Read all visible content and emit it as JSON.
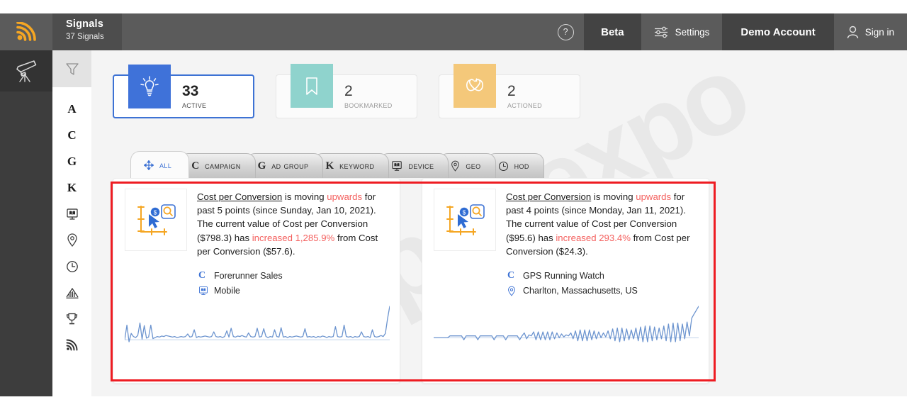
{
  "header": {
    "logo_icon": "rss-signal-icon",
    "title": "Signals",
    "subtitle": "37 Signals",
    "help_icon": "question-circle-icon",
    "beta_label": "Beta",
    "settings_icon": "sliders-icon",
    "settings_label": "Settings",
    "account_label": "Demo Account",
    "signin_icon": "user-icon",
    "signin_label": "Sign in"
  },
  "rail_dark": {
    "items": [
      {
        "name": "telescope-icon",
        "label": "Telescope"
      }
    ]
  },
  "rail_light": {
    "filter_icon": "filter-funnel-icon",
    "items": [
      {
        "icon": "letter-a-icon",
        "label": "A",
        "type": "letter"
      },
      {
        "icon": "letter-c-icon",
        "label": "C",
        "type": "letter"
      },
      {
        "icon": "letter-g-icon",
        "label": "G",
        "type": "letter"
      },
      {
        "icon": "letter-k-icon",
        "label": "K",
        "type": "letter"
      },
      {
        "icon": "device-monitor-icon",
        "label": "",
        "type": "glyph"
      },
      {
        "icon": "location-pin-icon",
        "label": "",
        "type": "glyph"
      },
      {
        "icon": "clock-icon",
        "label": "",
        "type": "glyph"
      },
      {
        "icon": "bar-chart-icon",
        "label": "",
        "type": "glyph"
      },
      {
        "icon": "trophy-icon",
        "label": "",
        "type": "glyph"
      },
      {
        "icon": "rss-signal-icon",
        "label": "",
        "type": "glyph"
      }
    ]
  },
  "watermark": {
    "text": "ppcexpo"
  },
  "stats": [
    {
      "count": "33",
      "label": "Active",
      "icon": "lightbulb-icon",
      "color": "#3f72d9",
      "state": "active"
    },
    {
      "count": "2",
      "label": "Bookmarked",
      "icon": "bookmark-icon",
      "color": "#8fd3cd",
      "state": "normal"
    },
    {
      "count": "2",
      "label": "Actioned",
      "icon": "actioned-link-icon",
      "color": "#f4c87a",
      "state": "normal"
    }
  ],
  "tabs": [
    {
      "label": "All",
      "icon": "move-arrows-icon",
      "selected": true
    },
    {
      "label": "Campaign",
      "icon": "letter-c-icon",
      "selected": false
    },
    {
      "label": "Ad Group",
      "icon": "letter-g-icon",
      "selected": false
    },
    {
      "label": "Keyword",
      "icon": "letter-k-icon",
      "selected": false
    },
    {
      "label": "Device",
      "icon": "device-monitor-icon",
      "selected": false
    },
    {
      "label": "Geo",
      "icon": "location-pin-icon",
      "selected": false
    },
    {
      "label": "HoD",
      "icon": "clock-icon",
      "selected": false
    }
  ],
  "cards": [
    {
      "thumb_icon": "money-chart-search-icon",
      "metric": "Cost per Conversion",
      "text_1": " is moving ",
      "direction": "upwards",
      "text_2": " for past 5 points (since Sunday, Jan 10, 2021). The current value of Cost per Conversion ($798.3) has ",
      "change": "increased 1,285.9%",
      "text_3": " from Cost per Conversion ($57.6).",
      "meta": [
        {
          "icon": "letter-c-icon",
          "label": "Forerunner Sales"
        },
        {
          "icon": "device-monitor-icon",
          "label": "Mobile"
        }
      ],
      "sparkline": {
        "color": "#6c94cf",
        "points": [
          14,
          42,
          10,
          26,
          20,
          18,
          22,
          46,
          15,
          41,
          17,
          19,
          42,
          16,
          18,
          20,
          19,
          21,
          20,
          22,
          21,
          20,
          19,
          20,
          18,
          19,
          20,
          19,
          20,
          25,
          19,
          20,
          33,
          18,
          20,
          19,
          20,
          21,
          20,
          19,
          20,
          29,
          20,
          19,
          20,
          18,
          20,
          31,
          19,
          36,
          20,
          19,
          21,
          20,
          22,
          20,
          19,
          27,
          20,
          19,
          20,
          36,
          19,
          20,
          35,
          20,
          18,
          20,
          19,
          33,
          20,
          19,
          37,
          19,
          20,
          18,
          20,
          19,
          20,
          21,
          20,
          19,
          20,
          35,
          19,
          20,
          19,
          20,
          18,
          20,
          19,
          21,
          20,
          18,
          20,
          19,
          20,
          39,
          20,
          19,
          20,
          42,
          20,
          19,
          20,
          18,
          20,
          19,
          20,
          29,
          20,
          19,
          20,
          18,
          33,
          20,
          19,
          20,
          22,
          20,
          26,
          54,
          78
        ]
      }
    },
    {
      "thumb_icon": "money-chart-search-icon",
      "metric": "Cost per Conversion",
      "text_1": " is moving ",
      "direction": "upwards",
      "text_2": " for past 4 points (since Monday, Jan 11, 2021). The current value of Cost per Conversion ($95.6) has ",
      "change": "increased 293.4%",
      "text_3": " from Cost per Conversion ($24.3).",
      "meta": [
        {
          "icon": "letter-c-icon",
          "label": "GPS Running Watch"
        },
        {
          "icon": "location-pin-icon",
          "label": "Charlton, Massachusetts, US"
        }
      ],
      "sparkline": {
        "color": "#6c94cf",
        "points": [
          16,
          16,
          16,
          16,
          16,
          16,
          16,
          20,
          20,
          20,
          20,
          20,
          20,
          12,
          20,
          20,
          20,
          20,
          20,
          12,
          20,
          20,
          20,
          20,
          20,
          20,
          12,
          20,
          20,
          20,
          20,
          12,
          20,
          20,
          20,
          20,
          20,
          12,
          20,
          26,
          14,
          22,
          20,
          28,
          12,
          28,
          12,
          28,
          12,
          28,
          12,
          28,
          14,
          26,
          16,
          24,
          18,
          22,
          20,
          26,
          14,
          30,
          10,
          32,
          10,
          32,
          10,
          32,
          12,
          30,
          14,
          28,
          16,
          26,
          18,
          30,
          14,
          34,
          10,
          36,
          8,
          36,
          10,
          34,
          12,
          32,
          14,
          36,
          10,
          38,
          8,
          40,
          8,
          40,
          10,
          38,
          12,
          36,
          14,
          40,
          10,
          44,
          8,
          46,
          8,
          46,
          10,
          44,
          14,
          48,
          20,
          56,
          64,
          72,
          80
        ]
      }
    }
  ],
  "highlight": {
    "color": "#ee1c22"
  }
}
